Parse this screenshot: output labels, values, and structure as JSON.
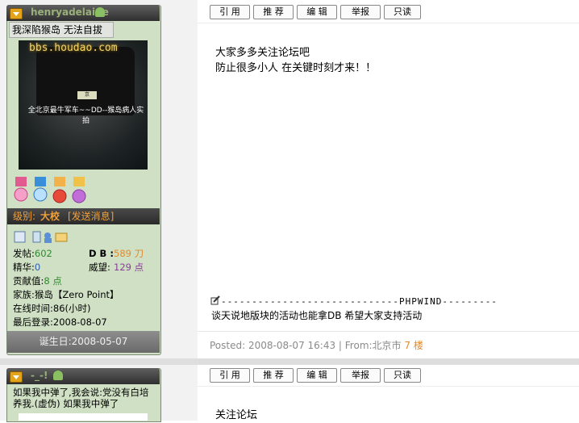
{
  "post1": {
    "username": "henryadelaide",
    "user_title": "我深陷猴岛 无法自拔",
    "avatar_watermark": "bbs.houdao.com",
    "avatar_caption": "全北京最牛军车~~DD--猴岛病人实拍",
    "plate_text": "京O.00705",
    "level_label": "级别:",
    "level_value": "大校",
    "send_message": "[发送消息]",
    "stats": {
      "posts_label": "发帖:",
      "posts_value": "602",
      "db_label": "D B :",
      "db_value": "589 刀",
      "essence_label": "精华:",
      "essence_value": "0",
      "prestige_label": "威望:",
      "prestige_value": "129 点",
      "contribution_label": "贡献值:",
      "contribution_value": "8 点",
      "family_label": "家族:",
      "family_value": "猴岛【Zero Point】",
      "online_label": "在线时间:86(小时)",
      "lastlogin_label": "最后登录:2008-08-07"
    },
    "birthday": "诞生日:2008-05-07",
    "buttons": [
      "引 用",
      "推 荐",
      "编 辑",
      "举报",
      "只读"
    ],
    "content_line1": "大家多多关注论坛吧",
    "content_line2": "防止很多小人  在关键时刻才来！！",
    "pw_rule": "-----------------------------PHPWIND---------",
    "signature": "谈天说地版块的活动也能拿DB 希望大家支持活动",
    "posted": "Posted: 2008-08-07 16:43 | From:北京市",
    "floor": "7 楼"
  },
  "post2": {
    "username": "-_-!",
    "user_title": "如果我中弹了,我会说:党没有白培养我.(虚伪) 如果我中弹了",
    "buttons": [
      "引 用",
      "推 荐",
      "编 辑",
      "举报",
      "只读"
    ],
    "content_line1": "关注论坛"
  },
  "colors": {
    "username_green": "#9ab07a",
    "rank_orange": "#f2a13a",
    "floor_orange": "#e28a2d"
  },
  "icons": [
    "arrow-down-icon",
    "online-user-icon",
    "medal-icons",
    "profile-icon",
    "document-icon",
    "add-friend-icon",
    "message-icon"
  ]
}
